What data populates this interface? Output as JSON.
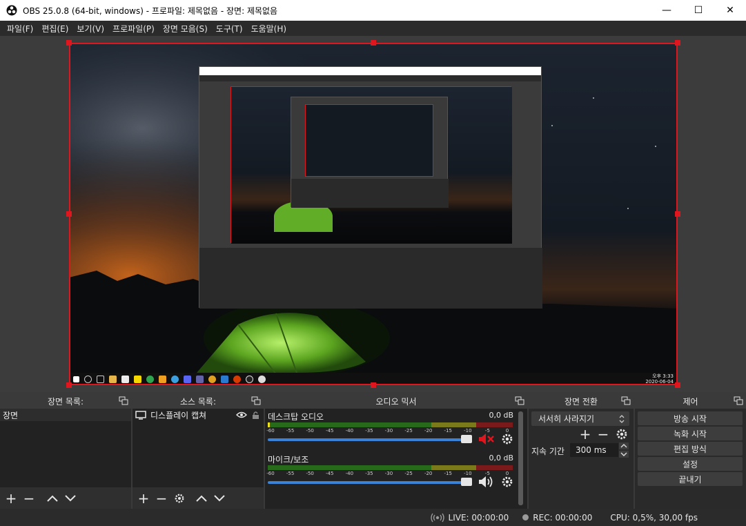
{
  "window": {
    "title": "OBS 25.0.8 (64-bit, windows) - 프로파일: 제목없음 - 장면: 제목없음",
    "minimize": "—",
    "maximize": "☐",
    "close": "✕"
  },
  "menu": [
    "파일(F)",
    "편집(E)",
    "보기(V)",
    "프로파일(P)",
    "장면 모음(S)",
    "도구(T)",
    "도움말(H)"
  ],
  "taskbar": {
    "time": "오후 3:33",
    "date": "2020-06-04"
  },
  "docks": {
    "scenes": {
      "title": "장면 목록:",
      "items": [
        "장면"
      ]
    },
    "sources": {
      "title": "소스 목록:",
      "items": [
        "디스플레이 캡쳐"
      ]
    },
    "mixer": {
      "title": "오디오 믹서",
      "channels": [
        {
          "name": "데스크탑 오디오",
          "db": "0,0 dB",
          "muted": true,
          "volume": 0.95
        },
        {
          "name": "마이크/보조",
          "db": "0,0 dB",
          "muted": false,
          "volume": 0.95
        }
      ],
      "scale": [
        "-60",
        "-55",
        "-50",
        "-45",
        "-40",
        "-35",
        "-30",
        "-25",
        "-20",
        "-15",
        "-10",
        "-5",
        "0"
      ]
    },
    "transitions": {
      "title": "장면 전환",
      "selected": "서서히 사라지기",
      "duration_label": "지속 기간",
      "duration_value": "300 ms"
    },
    "controls": {
      "title": "제어",
      "buttons": [
        "방송 시작",
        "녹화 시작",
        "편집 방식",
        "설정",
        "끝내기"
      ]
    }
  },
  "status": {
    "live": "LIVE: 00:00:00",
    "rec": "REC: 00:00:00",
    "cpu": "CPU: 0,5%, 30,00 fps"
  },
  "colors": {
    "selection": "#e0161e",
    "slider": "#3a83d6",
    "muted_icon": "#e0161e"
  }
}
